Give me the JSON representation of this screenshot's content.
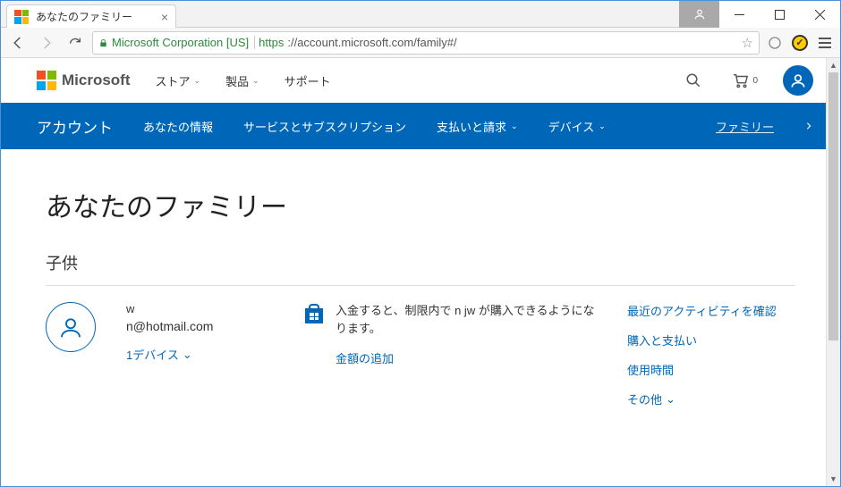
{
  "window": {
    "tab_title": "あなたのファミリー"
  },
  "omnibox": {
    "ev_cert": "Microsoft Corporation [US]",
    "url_scheme": "https",
    "url_rest": "://account.microsoft.com/family#/"
  },
  "ms_header": {
    "brand": "Microsoft",
    "links": [
      "ストア",
      "製品",
      "サポート"
    ],
    "cart_count": "0"
  },
  "subnav": {
    "brand": "アカウント",
    "links": [
      {
        "label": "あなたの情報",
        "chev": false
      },
      {
        "label": "サービスとサブスクリプション",
        "chev": false
      },
      {
        "label": "支払いと請求",
        "chev": true
      },
      {
        "label": "デバイス",
        "chev": true
      },
      {
        "label": "ファミリー",
        "chev": false,
        "active": true
      }
    ]
  },
  "content": {
    "page_title": "あなたのファミリー",
    "section_title": "子供",
    "child": {
      "name": "w",
      "email": "n@hotmail.com",
      "devices": "1デバイス",
      "store_text": "入金すると、制限内で n jw が購入できるようになります。",
      "store_action": "金額の追加",
      "links": [
        "最近のアクティビティを確認",
        "購入と支払い",
        "使用時間",
        "その他"
      ]
    }
  }
}
